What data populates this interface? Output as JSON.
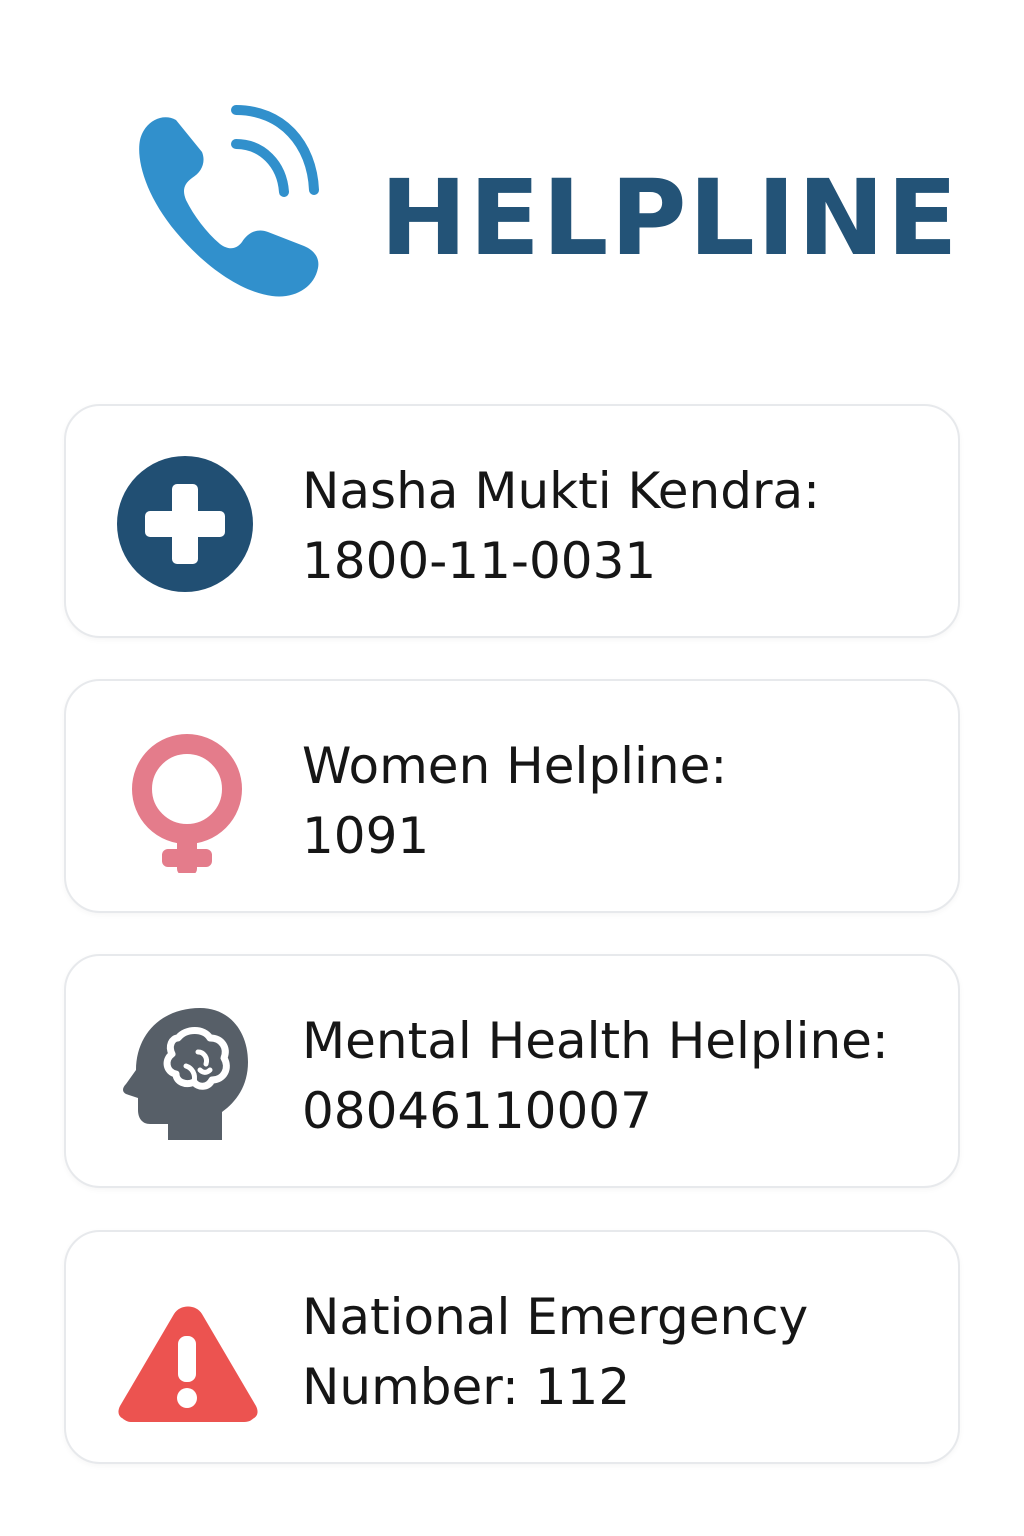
{
  "header": {
    "title": "HELPLINE",
    "icon": "phone-call-icon",
    "title_color": "#235377",
    "icon_color": "#3190cc"
  },
  "helplines": [
    {
      "name": "Nasha Mukti Kendra:",
      "number": "1800-11-0031",
      "icon": "medical-cross-icon",
      "icon_color": "#214f73"
    },
    {
      "name": "Women Helpline:",
      "number": "1091",
      "icon": "female-symbol-icon",
      "icon_color": "#e47c8b"
    },
    {
      "name": "Mental Health Helpline:",
      "number": "08046110007",
      "icon": "brain-head-icon",
      "icon_color": "#575f68"
    },
    {
      "name": "National Emergency",
      "number": "Number: 112",
      "icon": "warning-icon",
      "icon_color": "#ec5350"
    }
  ]
}
